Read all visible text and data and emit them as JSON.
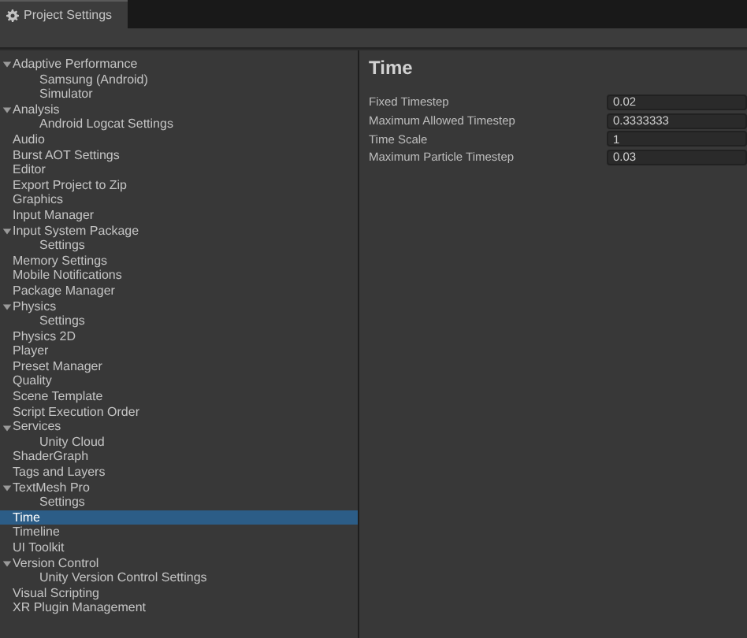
{
  "window": {
    "tab": {
      "label": "Project Settings",
      "selected": true
    }
  },
  "sidebar": {
    "items": [
      {
        "label": "Adaptive Performance",
        "selected": false,
        "expanded": true,
        "children": [
          {
            "label": "Samsung (Android)",
            "selected": false
          },
          {
            "label": "Simulator",
            "selected": false
          }
        ]
      },
      {
        "label": "Analysis",
        "selected": false,
        "expanded": true,
        "children": [
          {
            "label": "Android Logcat Settings",
            "selected": false
          }
        ]
      },
      {
        "label": "Audio",
        "selected": false
      },
      {
        "label": "Burst AOT Settings",
        "selected": false
      },
      {
        "label": "Editor",
        "selected": false
      },
      {
        "label": "Export Project to Zip",
        "selected": false
      },
      {
        "label": "Graphics",
        "selected": false
      },
      {
        "label": "Input Manager",
        "selected": false
      },
      {
        "label": "Input System Package",
        "selected": false,
        "expanded": true,
        "children": [
          {
            "label": "Settings",
            "selected": false
          }
        ]
      },
      {
        "label": "Memory Settings",
        "selected": false
      },
      {
        "label": "Mobile Notifications",
        "selected": false
      },
      {
        "label": "Package Manager",
        "selected": false
      },
      {
        "label": "Physics",
        "selected": false,
        "expanded": true,
        "children": [
          {
            "label": "Settings",
            "selected": false
          }
        ]
      },
      {
        "label": "Physics 2D",
        "selected": false
      },
      {
        "label": "Player",
        "selected": false
      },
      {
        "label": "Preset Manager",
        "selected": false
      },
      {
        "label": "Quality",
        "selected": false
      },
      {
        "label": "Scene Template",
        "selected": false
      },
      {
        "label": "Script Execution Order",
        "selected": false
      },
      {
        "label": "Services",
        "selected": false,
        "expanded": true,
        "children": [
          {
            "label": "Unity Cloud",
            "selected": false
          }
        ]
      },
      {
        "label": "ShaderGraph",
        "selected": false
      },
      {
        "label": "Tags and Layers",
        "selected": false
      },
      {
        "label": "TextMesh Pro",
        "selected": false,
        "expanded": true,
        "children": [
          {
            "label": "Settings",
            "selected": false
          }
        ]
      },
      {
        "label": "Time",
        "selected": true
      },
      {
        "label": "Timeline",
        "selected": false
      },
      {
        "label": "UI Toolkit",
        "selected": false
      },
      {
        "label": "Version Control",
        "selected": false,
        "expanded": true,
        "children": [
          {
            "label": "Unity Version Control Settings",
            "selected": false
          }
        ]
      },
      {
        "label": "Visual Scripting",
        "selected": false
      },
      {
        "label": "XR Plugin Management",
        "selected": false
      }
    ]
  },
  "panel": {
    "title": "Time",
    "fields": [
      {
        "label": "Fixed Timestep",
        "value": "0.02"
      },
      {
        "label": "Maximum Allowed Timestep",
        "value": "0.3333333"
      },
      {
        "label": "Time Scale",
        "value": "1"
      },
      {
        "label": "Maximum Particle Timestep",
        "value": "0.03"
      }
    ]
  }
}
